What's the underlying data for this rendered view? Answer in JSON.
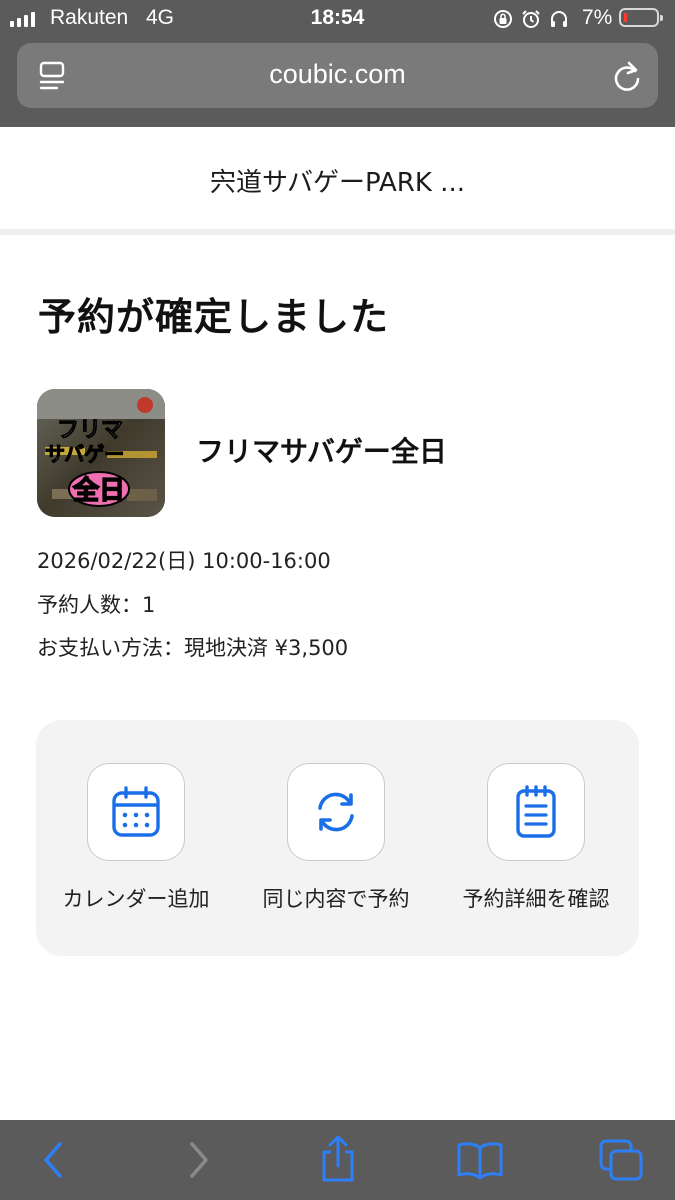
{
  "status_bar": {
    "carrier": "Rakuten",
    "network": "4G",
    "time": "18:54",
    "battery_percent": "7%",
    "battery_level": 0.07,
    "battery_color": "#ff3b30",
    "icons": [
      "orientation-lock-icon",
      "alarm-icon",
      "headphones-icon"
    ]
  },
  "browser": {
    "url": "coubic.com"
  },
  "site": {
    "title": "宍道サバゲーPARK ..."
  },
  "confirmation": {
    "heading": "予約が確定しました",
    "product": {
      "name": "フリマサバゲー全日",
      "thumbnail_text": [
        "フリマ",
        "サバゲー",
        "全日"
      ]
    },
    "details": {
      "datetime": "2026/02/22(日) 10:00-16:00",
      "people": "予約人数：1",
      "payment": "お支払い方法：現地決済 ¥3,500"
    }
  },
  "actions": [
    {
      "label": "カレンダー追加",
      "icon": "calendar-icon"
    },
    {
      "label": "同じ内容で予約",
      "icon": "refresh-icon"
    },
    {
      "label": "予約詳細を確認",
      "icon": "clipboard-list-icon"
    }
  ],
  "colors": {
    "accent": "#1a6fe8",
    "chrome_bg": "#5b5b5b",
    "toolbar_icon": "#2d7ff9",
    "card_bg": "#f3f3f3"
  }
}
